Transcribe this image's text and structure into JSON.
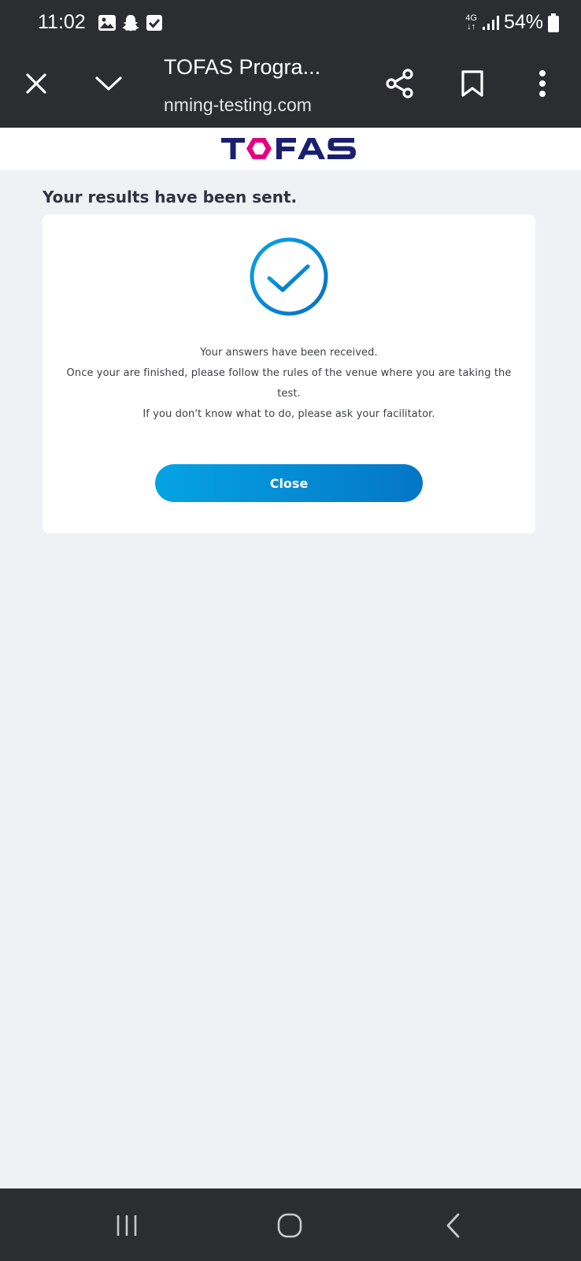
{
  "status_bar": {
    "time": "11:02",
    "left_icons": [
      "gallery-icon",
      "snapchat-icon",
      "checkbox-icon"
    ],
    "network_top": "4G",
    "network_bottom": "↓↑",
    "battery_percent": "54%"
  },
  "toolbar": {
    "title": "TOFAS Progra...",
    "url": "nming-testing.com",
    "icons": [
      "close-icon",
      "chevron-down-icon",
      "share-icon",
      "bookmark-icon",
      "more-vert-icon"
    ]
  },
  "site": {
    "logo_text": "TOFAS",
    "colors": {
      "logo_blue": "#1b1f6f",
      "logo_pink": "#e5007f"
    }
  },
  "result": {
    "heading": "Your results have been sent.",
    "messages": [
      "Your answers have been received.",
      "Once your are finished, please follow the rules of the venue where you are taking the",
      "test.",
      "If you don't know what to do, please ask your facilitator."
    ],
    "close_label": "Close",
    "accent_color": "#0a85d0"
  },
  "nav_bar": {
    "icons": [
      "recent-apps-icon",
      "home-icon",
      "back-icon"
    ]
  }
}
